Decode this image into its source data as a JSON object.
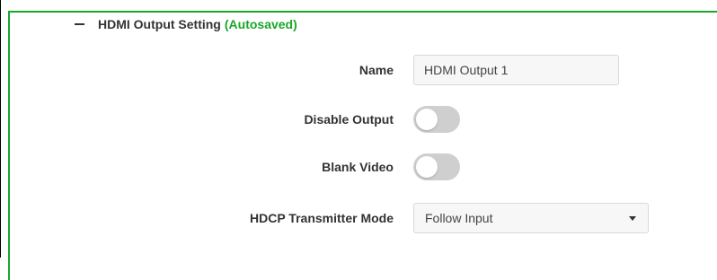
{
  "section": {
    "title": "HDMI Output Setting",
    "status": "(Autosaved)",
    "border_color": "#1aa62a",
    "collapse_icon": "minus-icon"
  },
  "fields": {
    "name": {
      "label": "Name",
      "value": "HDMI Output 1"
    },
    "disable_output": {
      "label": "Disable Output",
      "checked": false
    },
    "blank_video": {
      "label": "Blank Video",
      "checked": false
    },
    "hdcp_mode": {
      "label": "HDCP Transmitter Mode",
      "value": "Follow Input",
      "dropdown_icon": "caret-down-icon"
    }
  }
}
